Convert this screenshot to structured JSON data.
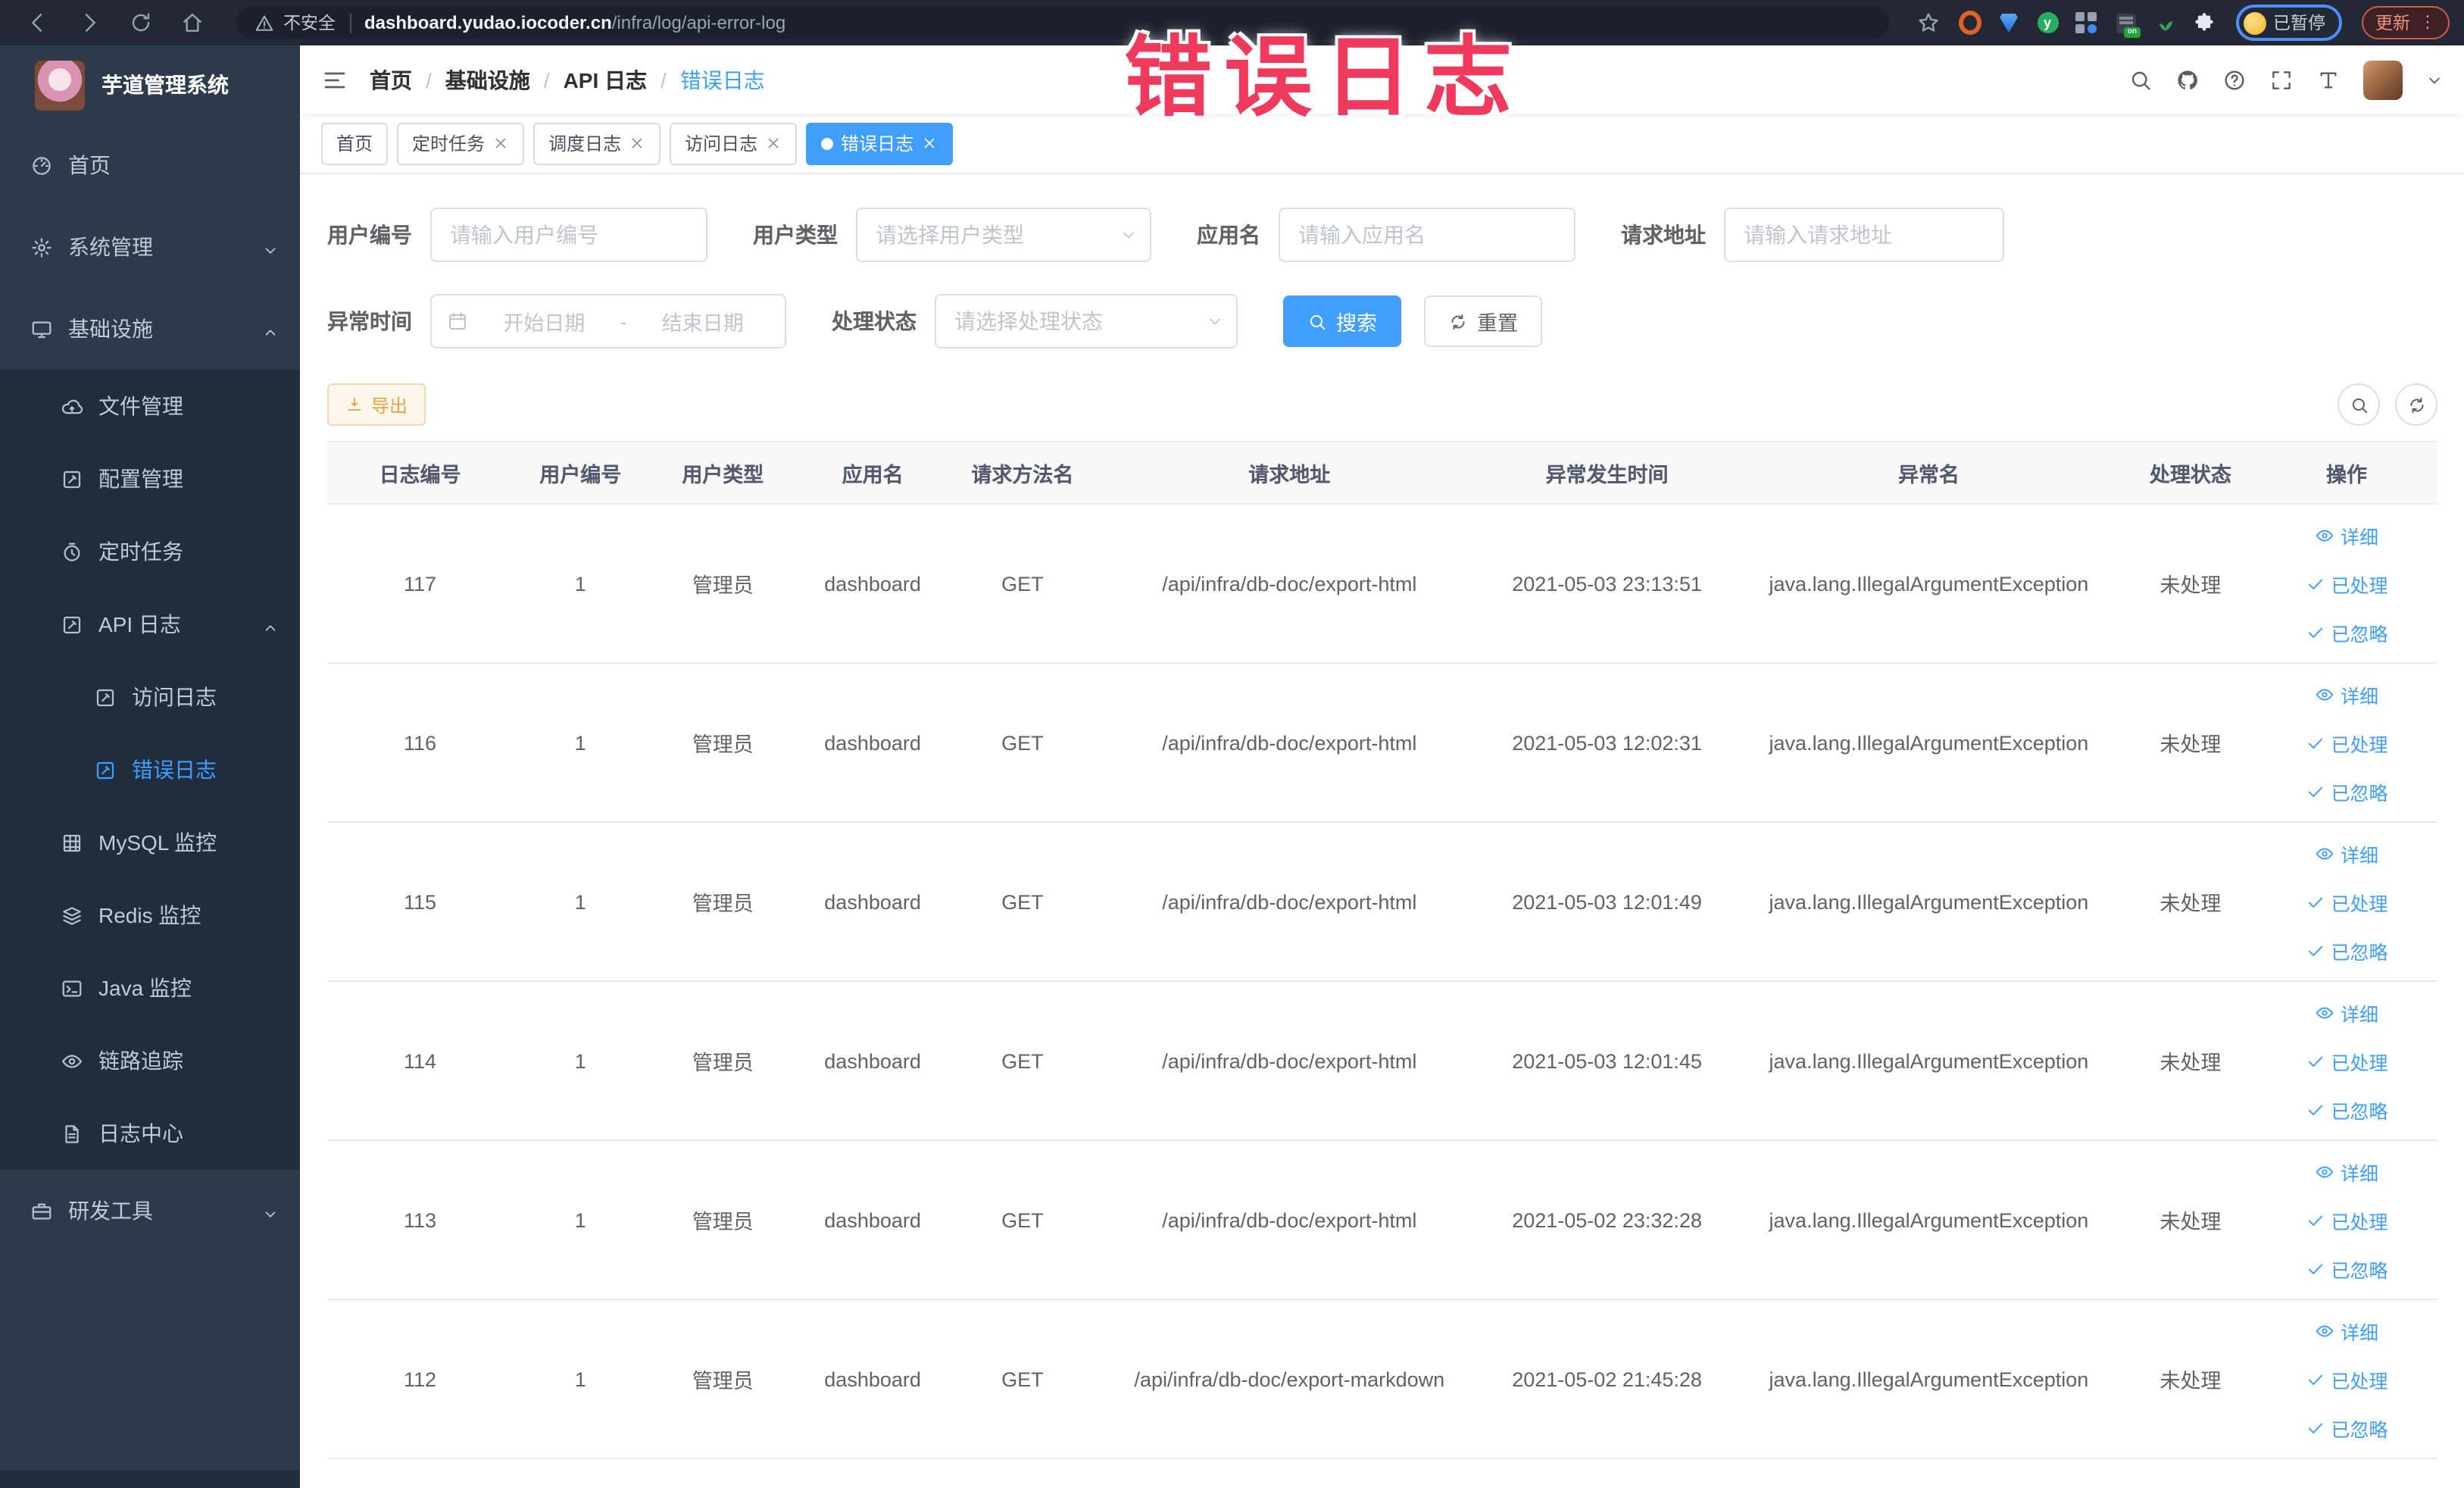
{
  "overlay": {
    "text": "错误日志"
  },
  "browser": {
    "security_label": "不安全",
    "url_host": "dashboard.yudao.iocoder.cn",
    "url_path": "/infra/log/api-error-log",
    "profile_badge": "已暂停",
    "update_label": "更新",
    "ext_green_letter": "y",
    "ext_on_label": "on"
  },
  "sidebar": {
    "app_title": "芋道管理系统",
    "items": [
      {
        "key": "home",
        "label": "首页",
        "icon": "dashboard",
        "indent": 20,
        "dark": false,
        "active": false,
        "chevron": null
      },
      {
        "key": "system",
        "label": "系统管理",
        "icon": "gear",
        "indent": 20,
        "dark": false,
        "active": false,
        "chevron": "down"
      },
      {
        "key": "infra",
        "label": "基础设施",
        "icon": "monitor",
        "indent": 20,
        "dark": false,
        "active": false,
        "chevron": "up"
      },
      {
        "key": "file-manage",
        "label": "文件管理",
        "icon": "cloud",
        "indent": 40,
        "dark": true,
        "active": false,
        "chevron": null
      },
      {
        "key": "config-manage",
        "label": "配置管理",
        "icon": "editsq",
        "indent": 40,
        "dark": true,
        "active": false,
        "chevron": null
      },
      {
        "key": "cron-job",
        "label": "定时任务",
        "icon": "timer",
        "indent": 40,
        "dark": true,
        "active": false,
        "chevron": null
      },
      {
        "key": "api-log",
        "label": "API 日志",
        "icon": "editsq",
        "indent": 40,
        "dark": true,
        "active": false,
        "chevron": "up"
      },
      {
        "key": "access-log",
        "label": "访问日志",
        "icon": "editsq",
        "indent": 62,
        "dark": true,
        "active": false,
        "chevron": null
      },
      {
        "key": "error-log",
        "label": "错误日志",
        "icon": "editsq",
        "indent": 62,
        "dark": true,
        "active": true,
        "chevron": null
      },
      {
        "key": "mysql-monitor",
        "label": "MySQL 监控",
        "icon": "grid",
        "indent": 40,
        "dark": true,
        "active": false,
        "chevron": null
      },
      {
        "key": "redis-monitor",
        "label": "Redis 监控",
        "icon": "stack",
        "indent": 40,
        "dark": true,
        "active": false,
        "chevron": null
      },
      {
        "key": "java-monitor",
        "label": "Java 监控",
        "icon": "terminal",
        "indent": 40,
        "dark": true,
        "active": false,
        "chevron": null
      },
      {
        "key": "trace",
        "label": "链路追踪",
        "icon": "eye",
        "indent": 40,
        "dark": true,
        "active": false,
        "chevron": null
      },
      {
        "key": "log-center",
        "label": "日志中心",
        "icon": "doc",
        "indent": 40,
        "dark": true,
        "active": false,
        "chevron": null
      },
      {
        "key": "dev-tools",
        "label": "研发工具",
        "icon": "briefcase",
        "indent": 20,
        "dark": false,
        "active": false,
        "chevron": "down"
      }
    ]
  },
  "header": {
    "breadcrumb": [
      "首页",
      "基础设施",
      "API 日志",
      "错误日志"
    ]
  },
  "tabs": [
    {
      "label": "首页",
      "closable": false,
      "active": false
    },
    {
      "label": "定时任务",
      "closable": true,
      "active": false
    },
    {
      "label": "调度日志",
      "closable": true,
      "active": false
    },
    {
      "label": "访问日志",
      "closable": true,
      "active": false
    },
    {
      "label": "错误日志",
      "closable": true,
      "active": true
    }
  ],
  "filters": {
    "user_id": {
      "label": "用户编号",
      "placeholder": "请输入用户编号"
    },
    "user_type": {
      "label": "用户类型",
      "placeholder": "请选择用户类型"
    },
    "app_name": {
      "label": "应用名",
      "placeholder": "请输入应用名"
    },
    "request_url": {
      "label": "请求地址",
      "placeholder": "请输入请求地址"
    },
    "exception_time": {
      "label": "异常时间",
      "start_placeholder": "开始日期",
      "separator": "-",
      "end_placeholder": "结束日期"
    },
    "process_status": {
      "label": "处理状态",
      "placeholder": "请选择处理状态"
    },
    "search_label": "搜索",
    "reset_label": "重置"
  },
  "toolbar": {
    "export_label": "导出"
  },
  "table": {
    "columns": [
      "日志编号",
      "用户编号",
      "用户类型",
      "应用名",
      "请求方法名",
      "请求地址",
      "异常发生时间",
      "异常名",
      "处理状态",
      "操作"
    ],
    "actions": [
      "详细",
      "已处理",
      "已忽略"
    ],
    "rows": [
      {
        "id": "117",
        "user_id": "1",
        "user_type": "管理员",
        "app": "dashboard",
        "method": "GET",
        "url": "/api/infra/db-doc/export-html",
        "time": "2021-05-03 23:13:51",
        "exception": "java.lang.IllegalArgumentException",
        "status": "未处理"
      },
      {
        "id": "116",
        "user_id": "1",
        "user_type": "管理员",
        "app": "dashboard",
        "method": "GET",
        "url": "/api/infra/db-doc/export-html",
        "time": "2021-05-03 12:02:31",
        "exception": "java.lang.IllegalArgumentException",
        "status": "未处理"
      },
      {
        "id": "115",
        "user_id": "1",
        "user_type": "管理员",
        "app": "dashboard",
        "method": "GET",
        "url": "/api/infra/db-doc/export-html",
        "time": "2021-05-03 12:01:49",
        "exception": "java.lang.IllegalArgumentException",
        "status": "未处理"
      },
      {
        "id": "114",
        "user_id": "1",
        "user_type": "管理员",
        "app": "dashboard",
        "method": "GET",
        "url": "/api/infra/db-doc/export-html",
        "time": "2021-05-03 12:01:45",
        "exception": "java.lang.IllegalArgumentException",
        "status": "未处理"
      },
      {
        "id": "113",
        "user_id": "1",
        "user_type": "管理员",
        "app": "dashboard",
        "method": "GET",
        "url": "/api/infra/db-doc/export-html",
        "time": "2021-05-02 23:32:28",
        "exception": "java.lang.IllegalArgumentException",
        "status": "未处理"
      },
      {
        "id": "112",
        "user_id": "1",
        "user_type": "管理员",
        "app": "dashboard",
        "method": "GET",
        "url": "/api/infra/db-doc/export-markdown",
        "time": "2021-05-02 21:45:28",
        "exception": "java.lang.IllegalArgumentException",
        "status": "未处理"
      }
    ]
  },
  "colors": {
    "accent": "#409eff",
    "sidebar": "#2d3a4b",
    "submenu": "#1f2d3d",
    "warning": "#e6a23c",
    "overlay": "#ee3a5c"
  }
}
